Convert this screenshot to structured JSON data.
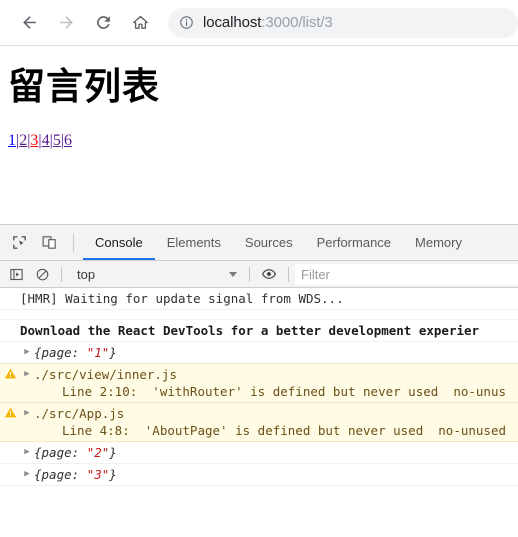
{
  "browser": {
    "nav": [
      {
        "name": "back-button",
        "icon": "arrow-left-icon",
        "enabled": true
      },
      {
        "name": "forward-button",
        "icon": "arrow-right-icon",
        "enabled": false
      },
      {
        "name": "reload-button",
        "icon": "reload-icon",
        "enabled": true
      },
      {
        "name": "home-button",
        "icon": "home-icon",
        "enabled": true
      }
    ],
    "omnibox": {
      "security_icon": "info-circle-icon",
      "host": "localhost",
      "path": ":3000/list/3",
      "full_url": "localhost:3000/list/3"
    }
  },
  "page": {
    "title": "留言列表",
    "pagination": {
      "separator": "|",
      "links": [
        {
          "label": "1",
          "state": "unvisited"
        },
        {
          "label": "2",
          "state": "visited"
        },
        {
          "label": "3",
          "state": "active"
        },
        {
          "label": "4",
          "state": "visited"
        },
        {
          "label": "5",
          "state": "visited"
        },
        {
          "label": "6",
          "state": "visited"
        }
      ]
    }
  },
  "devtools": {
    "toolbar_icons": [
      {
        "name": "inspect-element-icon",
        "label": "Inspect element"
      },
      {
        "name": "device-toolbar-icon",
        "label": "Toggle device toolbar"
      }
    ],
    "tabs": [
      {
        "label": "Console",
        "active": true
      },
      {
        "label": "Elements",
        "active": false
      },
      {
        "label": "Sources",
        "active": false
      },
      {
        "label": "Performance",
        "active": false
      },
      {
        "label": "Memory",
        "active": false
      }
    ],
    "console_toolbar": {
      "sidebar_icon": "console-sidebar-icon",
      "clear_icon": "clear-console-icon",
      "context": "top",
      "eye_icon": "live-expression-icon",
      "filter_placeholder": "Filter",
      "filter_value": ""
    },
    "messages": [
      {
        "kind": "plain",
        "text": "[HMR] Waiting for update signal from WDS..."
      },
      {
        "kind": "blank",
        "text": ""
      },
      {
        "kind": "bold",
        "text": "Download the React DevTools for a better development experier"
      },
      {
        "kind": "object",
        "prefix": "{page: ",
        "value": "\"1\"",
        "suffix": "}"
      },
      {
        "kind": "warning",
        "line1": "./src/view/inner.js",
        "line2": "Line 2:10:  'withRouter' is defined but never used  no-unus"
      },
      {
        "kind": "warning",
        "line1": "./src/App.js",
        "line2": "Line 4:8:  'AboutPage' is defined but never used  no-unused"
      },
      {
        "kind": "object",
        "prefix": "{page: ",
        "value": "\"2\"",
        "suffix": "}"
      },
      {
        "kind": "object",
        "prefix": "{page: ",
        "value": "\"3\"",
        "suffix": "}"
      }
    ]
  },
  "colors": {
    "accent_blue": "#1a73e8",
    "link_unvisited": "#0000ee",
    "link_visited": "#551a8b",
    "link_active": "#ff0000",
    "warning_bg": "#fffbe5",
    "warning_icon": "#f5b400",
    "string_red": "#c41a16"
  }
}
